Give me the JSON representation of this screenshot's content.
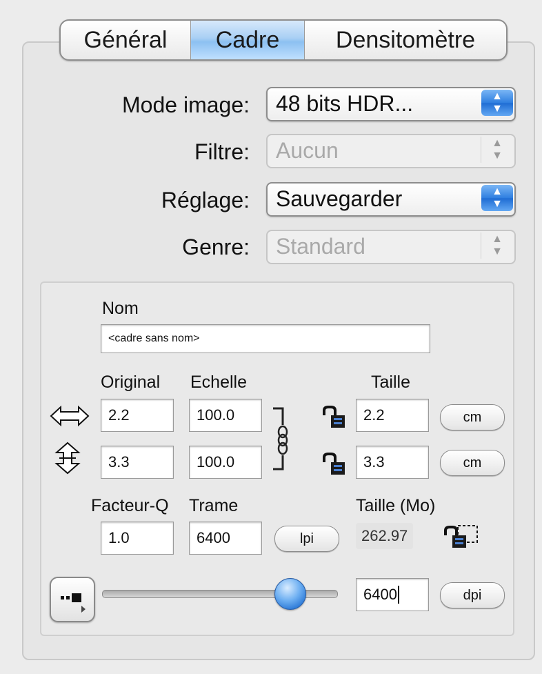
{
  "tabs": [
    "Général",
    "Cadre",
    "Densitomètre"
  ],
  "selected_tab": "Cadre",
  "form": {
    "mode_image": {
      "label": "Mode image:",
      "value": "48 bits HDR..."
    },
    "filtre": {
      "label": "Filtre:",
      "value": "Aucun"
    },
    "reglage": {
      "label": "Réglage:",
      "value": "Sauvegarder"
    },
    "genre": {
      "label": "Genre:",
      "value": "Standard"
    }
  },
  "frame": {
    "nom_label": "Nom",
    "nom_value": "<cadre sans nom>",
    "original_label": "Original",
    "echelle_label": "Echelle",
    "taille_label": "Taille",
    "width": {
      "original": "2.2",
      "echelle": "100.0",
      "taille": "2.2",
      "unit": "cm"
    },
    "height": {
      "original": "3.3",
      "echelle": "100.0",
      "taille": "3.3",
      "unit": "cm"
    },
    "facteur_label": "Facteur-Q",
    "trame_label": "Trame",
    "taille_mo_label": "Taille (Mo)",
    "facteur_value": "1.0",
    "trame_value": "6400",
    "trame_unit": "lpi",
    "taille_mo_value": "262.97",
    "resolution_value": "6400",
    "resolution_unit": "dpi",
    "slider_level": 0.8
  },
  "colors": {
    "selected_tab": "#9cc8f3",
    "popup_arrow": "#2f7fe0"
  }
}
